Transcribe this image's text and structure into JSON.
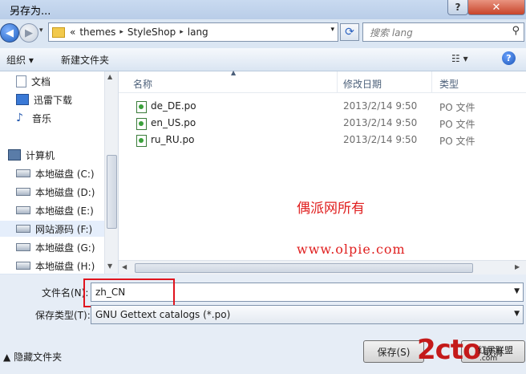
{
  "window": {
    "title": "另存为...",
    "help_label": "?",
    "close_label": "✕"
  },
  "nav": {
    "back_glyph": "◀",
    "forward_glyph": "▶",
    "dropdown_glyph": "▾",
    "address": {
      "prefix": "«",
      "crumbs": [
        "themes",
        "StyleShop",
        "lang"
      ],
      "separator": "▸",
      "dropdown_glyph": "▾"
    },
    "refresh_glyph": "⟳",
    "search": {
      "placeholder": "搜索 lang",
      "icon": "search-icon"
    }
  },
  "toolbar": {
    "organize": "组织 ▾",
    "new_folder": "新建文件夹",
    "view_glyph": "☷ ▾",
    "help_glyph": "?"
  },
  "sidebar": {
    "items": [
      {
        "label": "文档",
        "icon": "document-icon"
      },
      {
        "label": "迅雷下载",
        "icon": "download-icon"
      },
      {
        "label": "音乐",
        "icon": "music-icon"
      },
      {
        "label": "计算机",
        "icon": "computer-icon"
      },
      {
        "label": "本地磁盘 (C:)",
        "icon": "drive-icon"
      },
      {
        "label": "本地磁盘 (D:)",
        "icon": "drive-icon"
      },
      {
        "label": "本地磁盘 (E:)",
        "icon": "drive-icon"
      },
      {
        "label": "网站源码 (F:)",
        "icon": "drive-icon",
        "selected": true
      },
      {
        "label": "本地磁盘 (G:)",
        "icon": "drive-icon"
      },
      {
        "label": "本地磁盘 (H:)",
        "icon": "drive-icon"
      }
    ]
  },
  "file_list": {
    "columns": [
      "名称",
      "修改日期",
      "类型"
    ],
    "rows": [
      {
        "name": "de_DE.po",
        "date": "2013/2/14 9:50",
        "type": "PO 文件"
      },
      {
        "name": "en_US.po",
        "date": "2013/2/14 9:50",
        "type": "PO 文件"
      },
      {
        "name": "ru_RU.po",
        "date": "2013/2/14 9:50",
        "type": "PO 文件"
      }
    ]
  },
  "watermarks": {
    "chinese": "偶派网所有",
    "url": "www.olpie.com",
    "logo_main": "2cto",
    "logo_sub": ".com",
    "logo_tag": "红黑联盟"
  },
  "form": {
    "filename_label": "文件名(N):",
    "filename_value": "zh_CN",
    "filetype_label": "保存类型(T):",
    "filetype_value": "GNU Gettext catalogs (*.po)",
    "hide_folders": "隐藏文件夹",
    "save_label": "保存(S)",
    "cancel_label": "取消"
  },
  "colors": {
    "accent": "#1f5fbf",
    "highlight_box": "#e0141e",
    "watermark": "#e02020"
  }
}
